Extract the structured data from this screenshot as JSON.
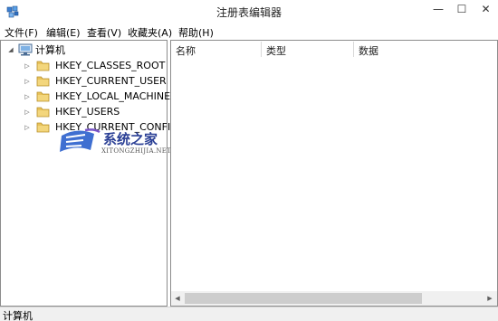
{
  "window": {
    "title": "注册表编辑器",
    "app_icon": "regedit-icon",
    "min_glyph": "—",
    "max_glyph": "☐",
    "close_glyph": "✕"
  },
  "menu": [
    "文件(F)",
    "编辑(E)",
    "查看(V)",
    "收藏夹(A)",
    "帮助(H)"
  ],
  "tree": {
    "root": {
      "label": "计算机",
      "expander": "◢",
      "icon": "computer-icon"
    },
    "items": [
      {
        "label": "HKEY_CLASSES_ROOT",
        "expander": "▷",
        "icon": "folder-icon"
      },
      {
        "label": "HKEY_CURRENT_USER",
        "expander": "▷",
        "icon": "folder-icon"
      },
      {
        "label": "HKEY_LOCAL_MACHINE",
        "expander": "▷",
        "icon": "folder-icon"
      },
      {
        "label": "HKEY_USERS",
        "expander": "▷",
        "icon": "folder-icon"
      },
      {
        "label": "HKEY_CURRENT_CONFIG",
        "expander": "▷",
        "icon": "folder-icon"
      }
    ]
  },
  "list": {
    "columns": [
      "名称",
      "类型",
      "数据"
    ],
    "rows": []
  },
  "scrollbar": {
    "left_glyph": "◀",
    "right_glyph": "▶"
  },
  "status": {
    "path": "计算机"
  },
  "watermark": {
    "text": "系统之家",
    "url": "XITONGZHIJIA.NET"
  },
  "colors": {
    "folder": "#e8c25a",
    "watermark_text": "#2a3f95"
  }
}
